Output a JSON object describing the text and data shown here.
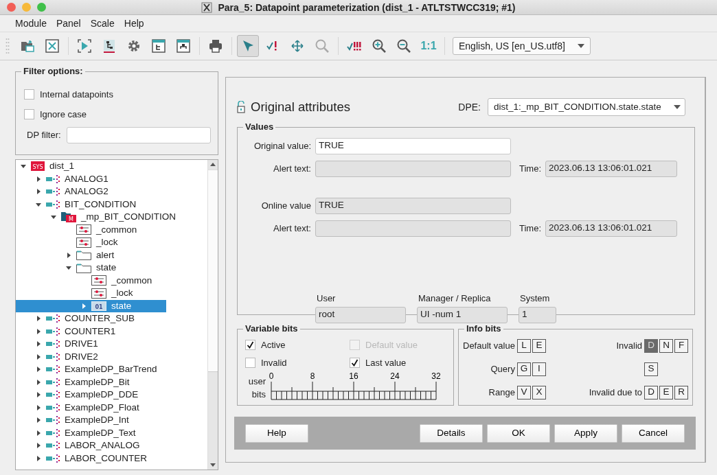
{
  "window": {
    "title": "Para_5: Datapoint parameterization (dist_1 - ATLTSTWCC319; #1)"
  },
  "menu": [
    {
      "label": "Module"
    },
    {
      "label": "Panel"
    },
    {
      "label": "Scale"
    },
    {
      "label": "Help"
    }
  ],
  "toolbar": [
    {
      "kind": "open-panel",
      "selected": false
    },
    {
      "kind": "close-panel",
      "selected": false
    },
    {
      "kind": "separator"
    },
    {
      "kind": "run",
      "selected": false
    },
    {
      "kind": "tree",
      "selected": false
    },
    {
      "kind": "gear",
      "selected": false
    },
    {
      "kind": "panel-tree",
      "selected": false
    },
    {
      "kind": "panel-org",
      "selected": false
    },
    {
      "kind": "separator"
    },
    {
      "kind": "print",
      "selected": false
    },
    {
      "kind": "separator"
    },
    {
      "kind": "pointer",
      "selected": true
    },
    {
      "kind": "check-warn",
      "selected": false
    },
    {
      "kind": "move",
      "selected": false
    },
    {
      "kind": "search",
      "selected": false
    },
    {
      "kind": "separator"
    },
    {
      "kind": "check-alert",
      "selected": false
    },
    {
      "kind": "zoom-in",
      "selected": false
    },
    {
      "kind": "zoom-out",
      "selected": false
    },
    {
      "kind": "text",
      "text": "1:1",
      "selected": false
    },
    {
      "kind": "separator"
    },
    {
      "kind": "combo",
      "value": "English, US [en_US.utf8]"
    }
  ],
  "filter": {
    "title": "Filter options:",
    "checkboxes": [
      {
        "label": "Internal datapoints",
        "checked": false
      },
      {
        "label": "Ignore case",
        "checked": false
      }
    ],
    "dp_filter_label": "DP filter:"
  },
  "tree": [
    {
      "label": "dist_1",
      "kind": "system",
      "icon_text": "SYS",
      "expanded": true,
      "selected": false,
      "children": [
        {
          "label": "ANALOG1",
          "kind": "datapoint",
          "expanded": false,
          "selected": false
        },
        {
          "label": "ANALOG2",
          "kind": "datapoint",
          "expanded": false,
          "selected": false
        },
        {
          "label": "BIT_CONDITION",
          "kind": "datapoint",
          "expanded": true,
          "selected": false,
          "children": [
            {
              "label": "_mp_BIT_CONDITION",
              "kind": "master",
              "icon_text": "M",
              "expanded": true,
              "selected": false,
              "children": [
                {
                  "label": "_common",
                  "kind": "config",
                  "selected": false
                },
                {
                  "label": "_lock",
                  "kind": "config",
                  "selected": false
                },
                {
                  "label": "alert",
                  "kind": "folder",
                  "expanded": false,
                  "selected": false
                },
                {
                  "label": "state",
                  "kind": "folder",
                  "expanded": true,
                  "selected": false,
                  "children": [
                    {
                      "label": "_common",
                      "kind": "config",
                      "selected": false
                    },
                    {
                      "label": "_lock",
                      "kind": "config",
                      "selected": false
                    },
                    {
                      "label": "state",
                      "kind": "element",
                      "icon_text": "01",
                      "expanded": false,
                      "selected": true
                    }
                  ]
                }
              ]
            }
          ]
        },
        {
          "label": "COUNTER_SUB",
          "kind": "datapoint",
          "expanded": false,
          "selected": false
        },
        {
          "label": "COUNTER1",
          "kind": "datapoint",
          "expanded": false,
          "selected": false
        },
        {
          "label": "DRIVE1",
          "kind": "datapoint",
          "expanded": false,
          "selected": false
        },
        {
          "label": "DRIVE2",
          "kind": "datapoint",
          "expanded": false,
          "selected": false
        },
        {
          "label": "ExampleDP_BarTrend",
          "kind": "datapoint",
          "expanded": false,
          "selected": false
        },
        {
          "label": "ExampleDP_Bit",
          "kind": "datapoint",
          "expanded": false,
          "selected": false
        },
        {
          "label": "ExampleDP_DDE",
          "kind": "datapoint",
          "expanded": false,
          "selected": false
        },
        {
          "label": "ExampleDP_Float",
          "kind": "datapoint",
          "expanded": false,
          "selected": false
        },
        {
          "label": "ExampleDP_Int",
          "kind": "datapoint",
          "expanded": false,
          "selected": false
        },
        {
          "label": "ExampleDP_Text",
          "kind": "datapoint",
          "expanded": false,
          "selected": false
        },
        {
          "label": "LABOR_ANALOG",
          "kind": "datapoint",
          "expanded": false,
          "selected": false
        },
        {
          "label": "LABOR_COUNTER",
          "kind": "datapoint",
          "expanded": false,
          "selected": false
        }
      ]
    }
  ],
  "header": {
    "title": "Original attributes",
    "dpe_label": "DPE:",
    "dpe_value": "dist_1:_mp_BIT_CONDITION.state.state"
  },
  "values": {
    "title": "Values",
    "rows": [
      {
        "label": "Original value:",
        "value": "TRUE",
        "editable": true
      },
      {
        "label": "Alert text:",
        "value": "",
        "editable": false,
        "time_label": "Time:",
        "time": "2023.06.13 13:06:01.021"
      },
      {
        "label": "Online value",
        "value": "TRUE",
        "editable": false
      },
      {
        "label": "Alert text:",
        "value": "",
        "editable": false,
        "time_label": "Time:",
        "time": "2023.06.13 13:06:01.021"
      }
    ],
    "source": [
      {
        "label": "User",
        "value": "root"
      },
      {
        "label": "Manager / Replica",
        "value": "UI -num 1"
      },
      {
        "label": "System",
        "value": "1"
      }
    ]
  },
  "variable_bits": {
    "title": "Variable bits",
    "checkboxes": [
      {
        "label": "Active",
        "checked": true,
        "disabled": false
      },
      {
        "label": "Default value",
        "checked": false,
        "disabled": true
      },
      {
        "label": "Invalid",
        "checked": false,
        "disabled": false
      },
      {
        "label": "Last value",
        "checked": true,
        "disabled": false
      }
    ],
    "user_bits_label": "user bits",
    "ticks": [
      "0",
      "8",
      "16",
      "24",
      "32"
    ]
  },
  "info_bits": {
    "title": "Info bits",
    "left": [
      {
        "label": "Default value",
        "bits": [
          {
            "text": "L",
            "on": false
          },
          {
            "text": "E",
            "on": false
          }
        ]
      },
      {
        "label": "Query",
        "bits": [
          {
            "text": "G",
            "on": false
          },
          {
            "text": "I",
            "on": false
          }
        ]
      },
      {
        "label": "Range",
        "bits": [
          {
            "text": "V",
            "on": false
          },
          {
            "text": "X",
            "on": false
          }
        ]
      }
    ],
    "right": [
      {
        "label": "Invalid",
        "bits": [
          {
            "text": "D",
            "on": true
          },
          {
            "text": "N",
            "on": false
          },
          {
            "text": "F",
            "on": false
          }
        ]
      },
      {
        "bits": [
          {
            "text": "S",
            "on": false
          }
        ]
      },
      {
        "label": "Invalid due to",
        "bits": [
          {
            "text": "D",
            "on": false
          },
          {
            "text": "E",
            "on": false
          },
          {
            "text": "R",
            "on": false
          }
        ]
      }
    ]
  },
  "buttons_left": [
    "Help"
  ],
  "buttons_right": [
    "Details",
    "OK",
    "Apply",
    "Cancel"
  ]
}
